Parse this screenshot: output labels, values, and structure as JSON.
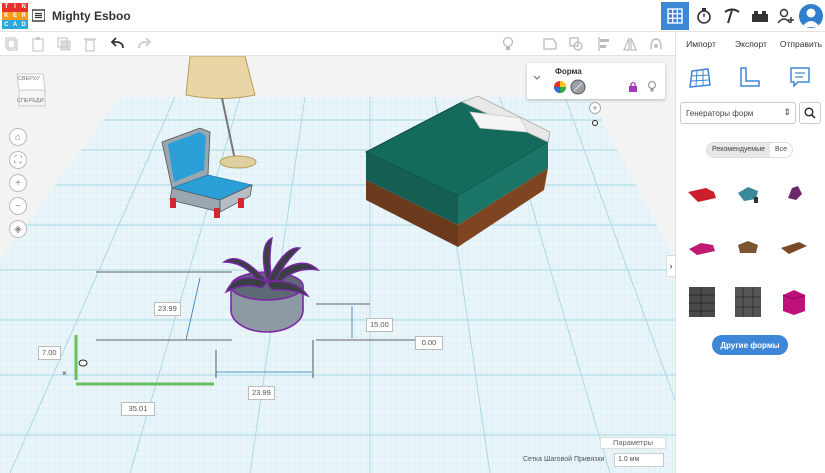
{
  "app": {
    "logo_letters": [
      "T",
      "I",
      "N",
      "K",
      "E",
      "R",
      "C",
      "A",
      "D"
    ],
    "title": "Mighty Esboo"
  },
  "topbar": {
    "view_3d_icon": "grid-view-icon",
    "icons": [
      "grid-view-icon",
      "timer-icon",
      "pickaxe-icon",
      "bricks-icon",
      "add-user-icon"
    ]
  },
  "panel": {
    "tabs": [
      "Импорт",
      "Экспорт",
      "Отправить"
    ],
    "generator_label": "Генераторы форм",
    "filter_tabs": [
      "Рекомендуемые",
      "Все"
    ],
    "more_shapes": "Другие формы"
  },
  "inspector": {
    "title": "Форма"
  },
  "viewcube": {
    "top": "СВЕРХУ",
    "front": "СПЕРЕДИ"
  },
  "dimensions": {
    "height_left": "23.99",
    "height_right": "15.00",
    "elevation": "0.00",
    "depth": "7.00",
    "width": "23.99",
    "length": "35.01"
  },
  "footer": {
    "settings": "Параметры",
    "snap_label": "Сетка Шаговой Привязки",
    "snap_value": "1.0 мм"
  },
  "colors": {
    "accent": "#3d87d6",
    "grid": "#bfe3ee",
    "selection": "#7a28a8"
  }
}
